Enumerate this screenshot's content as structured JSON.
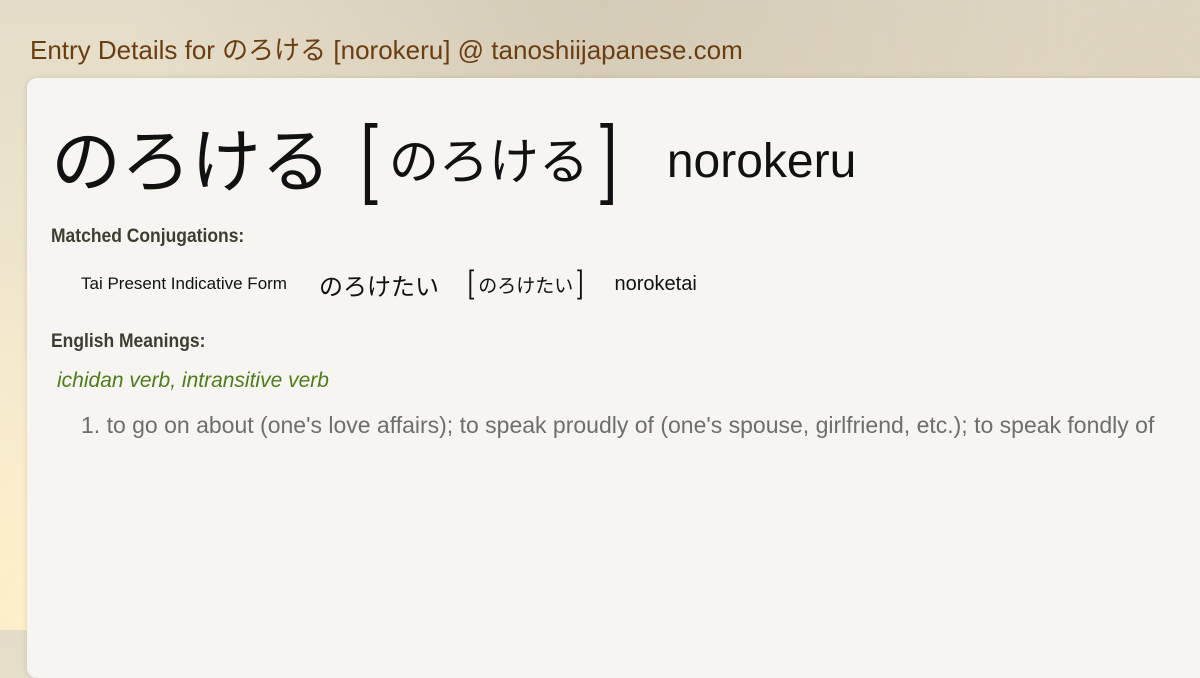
{
  "page": {
    "title": "Entry Details for のろける [norokeru] @ tanoshiijapanese.com"
  },
  "entry": {
    "kana": "のろける",
    "reading": "のろける",
    "romaji": "norokeru",
    "open_bracket": "[",
    "close_bracket": "]"
  },
  "conjugations": {
    "label": "Matched Conjugations:",
    "items": [
      {
        "form": "Tai Present Indicative Form",
        "kana": "のろけたい",
        "reading": "のろけたい",
        "romaji": "noroketai"
      }
    ]
  },
  "meanings": {
    "label": "English Meanings:",
    "pos": "ichidan verb, intransitive verb",
    "items": [
      "1. to go on about (one's love affairs); to speak proudly of (one's spouse, girlfriend, etc.); to speak fondly of"
    ]
  },
  "colors": {
    "title": "#6b3e12",
    "pos": "#4e7c1a",
    "meaning": "#6e6e6e",
    "card": "#f6f5f2"
  }
}
